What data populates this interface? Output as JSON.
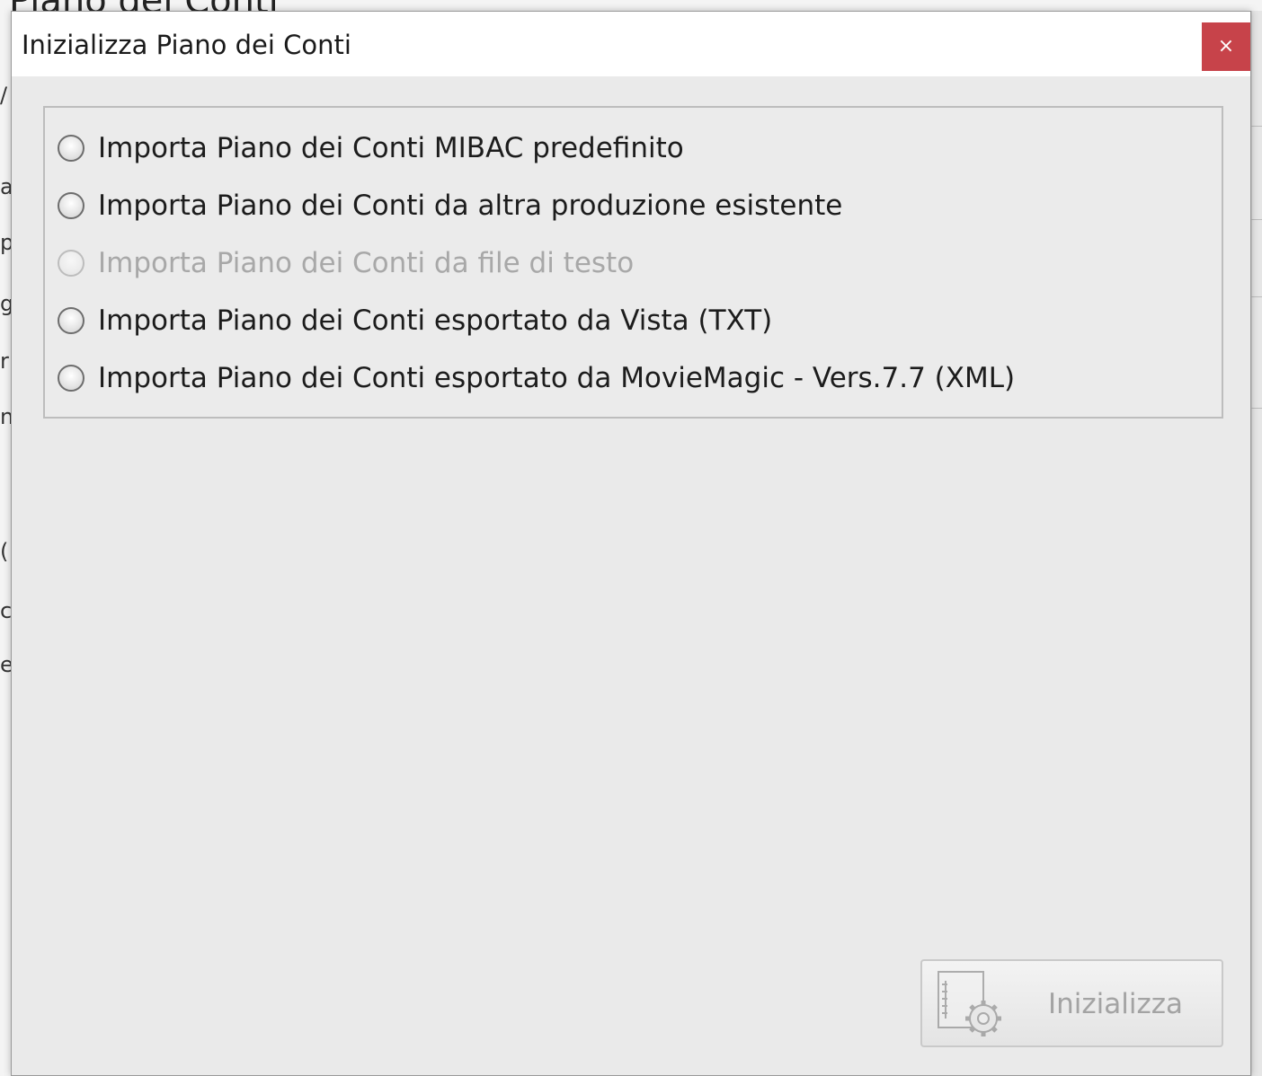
{
  "background_app": {
    "title_fragment": "Piano dei Conti",
    "left_letters": [
      "/",
      "a",
      "p",
      "g",
      "r",
      "n",
      "(",
      "c",
      "e"
    ]
  },
  "dialog": {
    "title": "Inizializza Piano dei Conti",
    "close_label": "×",
    "options": [
      {
        "label": "Importa Piano dei Conti MIBAC predefinito",
        "enabled": true,
        "selected": false
      },
      {
        "label": "Importa Piano dei Conti da altra produzione esistente",
        "enabled": true,
        "selected": false
      },
      {
        "label": "Importa Piano dei Conti da file di testo",
        "enabled": false,
        "selected": false
      },
      {
        "label": "Importa Piano dei Conti esportato da Vista (TXT)",
        "enabled": true,
        "selected": false
      },
      {
        "label": "Importa Piano dei Conti esportato da MovieMagic - Vers.7.7 (XML)",
        "enabled": true,
        "selected": false
      }
    ],
    "action_button": {
      "label": "Inizializza",
      "icon": "document-gear-icon",
      "enabled": false
    }
  },
  "colors": {
    "close_button": "#c7434a",
    "dialog_background": "#eaeaea",
    "titlebar": "#ffffff",
    "disabled_text": "#a8a8a8"
  }
}
